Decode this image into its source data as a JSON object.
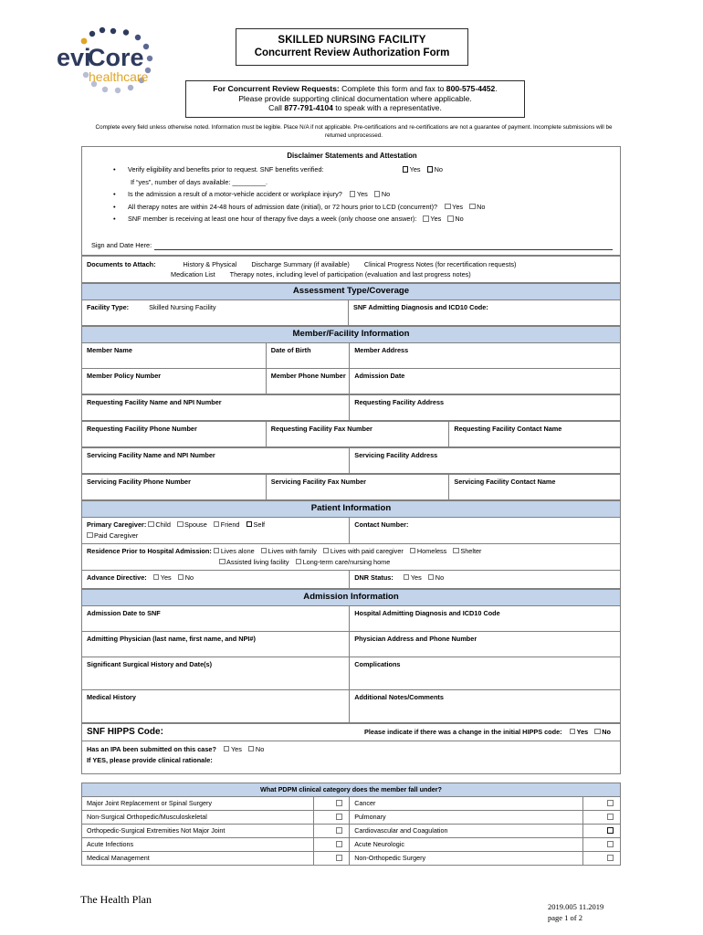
{
  "logo": {
    "name_part1": "evi",
    "name_part2": "Core",
    "tagline": "healthcare",
    "navy": "#2e3a5c",
    "gold": "#e0a526",
    "dot_light": "#b9bed4"
  },
  "header": {
    "title_line1": "SKILLED NURSING FACILITY",
    "title_line2": "Concurrent Review Authorization Form",
    "fax_line1_bold": "For Concurrent Review Requests:",
    "fax_line1_rest": " Complete this form and fax to ",
    "fax_line1_number": "800-575-4452",
    "fax_line1_end": ".",
    "fax_line2": "Please provide supporting clinical documentation where applicable.",
    "fax_line3_pre": "Call ",
    "fax_line3_number": "877-791-4104",
    "fax_line3_post": " to speak with a representative.",
    "notice": "Complete every field unless otherwise noted.  Information must be legible.  Place N/A if not applicable.  Pre-certifications and re-certifications are not a guarantee of payment.  Incomplete submissions will be returned unprocessed."
  },
  "disclaimer": {
    "title": "Disclaimer Statements and Attestation",
    "item1": "Verify eligibility and benefits prior to request.  SNF benefits verified:",
    "item1_sub": "If “yes”, number of days available: _________.",
    "item2": "Is the admission a result of a motor-vehicle accident or workplace injury?",
    "item3": "All therapy notes are within 24-48 hours of admission date (initial), or 72 hours prior to LCD (concurrent)?",
    "item4": "SNF member is receiving at least one hour of therapy five days a week (only choose one answer):",
    "yes": "Yes",
    "no": "No",
    "sign_label": "Sign and Date Here:"
  },
  "documents": {
    "label": "Documents to Attach:",
    "line1_a": "History & Physical",
    "line1_b": "Discharge Summary (if available)",
    "line1_c": "Clinical Progress Notes (for recertification requests)",
    "line2_a": "Medication List",
    "line2_b": "Therapy notes, including level of participation (evaluation and last progress notes)"
  },
  "assessment": {
    "band": "Assessment Type/Coverage",
    "facility_type_label": "Facility Type:",
    "facility_type_value": "Skilled Nursing Facility",
    "snf_diagnosis": "SNF Admitting Diagnosis and ICD10 Code:"
  },
  "member": {
    "band": "Member/Facility Information",
    "member_name": "Member Name",
    "date_of_birth": "Date of Birth",
    "member_address": "Member Address",
    "member_policy_number": "Member Policy Number",
    "member_phone_number": "Member Phone Number",
    "admission_date": "Admission Date",
    "req_name_npi": "Requesting Facility Name and NPI Number",
    "req_address": "Requesting Facility Address",
    "req_phone": "Requesting Facility Phone Number",
    "req_fax": "Requesting Facility Fax Number",
    "req_contact": "Requesting Facility Contact Name",
    "svc_name_npi": "Servicing Facility Name and NPI Number",
    "svc_address": "Servicing Facility Address",
    "svc_phone": "Servicing Facility Phone Number",
    "svc_fax": "Servicing Facility Fax Number",
    "svc_contact": "Servicing Facility Contact Name"
  },
  "patient": {
    "band": "Patient Information",
    "primary_caregiver_label": "Primary Caregiver:",
    "caregiver_options": [
      "Child",
      "Spouse",
      "Friend",
      "Self",
      "Paid Caregiver"
    ],
    "contact_number": "Contact Number:",
    "residence_label": "Residence Prior to Hospital Admission:",
    "residence_options": [
      "Lives alone",
      "Lives with family",
      "Lives with paid caregiver",
      "Homeless",
      "Shelter",
      "Assisted living facility",
      "Long-term care/nursing home"
    ],
    "advance_directive": "Advance Directive:",
    "dnr_status": "DNR Status:",
    "yes": "Yes",
    "no": "No"
  },
  "admission": {
    "band": "Admission Information",
    "admission_date_snf": "Admission Date to SNF",
    "hospital_diagnosis": "Hospital Admitting Diagnosis and ICD10 Code",
    "admitting_physician": "Admitting Physician (last name, first name, and NPI#)",
    "physician_address": "Physician Address and Phone Number",
    "surgical_history": "Significant Surgical History and Date(s)",
    "complications": "Complications",
    "medical_history": "Medical History",
    "additional_notes": "Additional Notes/Comments"
  },
  "hipps": {
    "label": "SNF HIPPS Code:",
    "change_question": "Please indicate if there was a change in the initial HIPPS code:",
    "yes": "Yes",
    "no": "No",
    "ipa_question": "Has an IPA been submitted on this case?",
    "ipa_yes": "Yes",
    "ipa_no": "No",
    "ipa_rationale": "If YES, please provide clinical rationale:"
  },
  "pdpm": {
    "band": "What PDPM clinical category does the member fall under?",
    "rows": [
      {
        "left": "Major Joint Replacement or Spinal Surgery",
        "left_checked": false,
        "right": "Cancer",
        "right_checked": false
      },
      {
        "left": "Non-Surgical Orthopedic/Musculoskeletal",
        "left_checked": false,
        "right": "Pulmonary",
        "right_checked": false
      },
      {
        "left": "Orthopedic-Surgical Extremities Not Major Joint",
        "left_checked": false,
        "right": "Cardiovascular and Coagulation",
        "right_checked": true
      },
      {
        "left": "Acute Infections",
        "left_checked": false,
        "right": "Acute Neurologic",
        "right_checked": false
      },
      {
        "left": "Medical Management",
        "left_checked": false,
        "right": "Non-Orthopedic Surgery",
        "right_checked": false
      }
    ]
  },
  "footer": {
    "health_plan": "The Health Plan",
    "version": "2019.005 11.2019",
    "page": "page 1 of 2"
  }
}
